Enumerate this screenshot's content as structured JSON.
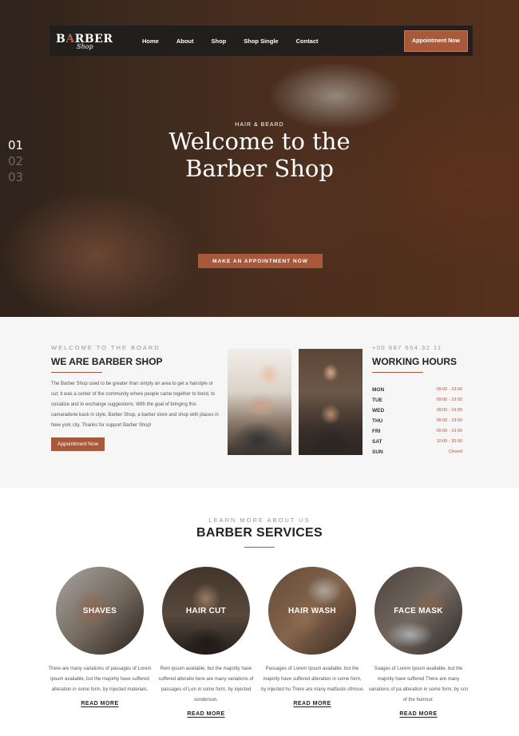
{
  "brand": {
    "logo_main_prefix": "B",
    "logo_main_accent": "A",
    "logo_main_suffix": "RBER",
    "logo_sub": "Shop",
    "accent_color": "#a8593b"
  },
  "nav": {
    "items": [
      "Home",
      "About",
      "Shop",
      "Shop Single",
      "Contact"
    ],
    "appointment_button": "Appointment Now"
  },
  "hero": {
    "slides": [
      "01",
      "02",
      "03"
    ],
    "active_slide": 0,
    "eyebrow": "HAIR & BEARD",
    "title_line1": "Welcome to the",
    "title_line2": "Barber Shop",
    "cta": "MAKE AN APPOINTMENT NOW"
  },
  "about": {
    "eyebrow": "WELCOME TO THE BOARD",
    "title": "WE ARE BARBER SHOP",
    "paragraph": "The Barber Shop used to be greater than simply an area to get a hairstyle or cut; it was a center of the community where people came together to bond, to socialize and to exchange suggestions. With the goal of bringing this camaraderie back in style, Barber Shop, a barber store and shop with places in New york city. Thanks for support Barber Shop!",
    "button": "Appointment Now"
  },
  "hours": {
    "phone": "+00 987 654 32 11",
    "title": "WORKING HOURS",
    "rows": [
      {
        "day": "MON",
        "time": "09:00 - 19:00"
      },
      {
        "day": "TUE",
        "time": "09:00 - 19:00"
      },
      {
        "day": "WED",
        "time": "09:00 - 19:00"
      },
      {
        "day": "THU",
        "time": "09:00 - 19:00"
      },
      {
        "day": "FRI",
        "time": "09:00 - 19:00"
      },
      {
        "day": "SAT",
        "time": "10:00 - 20:00"
      },
      {
        "day": "SUN",
        "time": "Closed"
      }
    ]
  },
  "services": {
    "eyebrow": "LEARN MORE ABOUT US",
    "title": "BARBER SERVICES",
    "items": [
      {
        "label": "SHAVES",
        "text": "There are many variations of passages of Lorem Ipsum available, but the majority have suffered alteration in some form, by injected materials.",
        "link": "READ MORE"
      },
      {
        "label": "HAIR CUT",
        "text": "Rem ipsum available, but the majority have suffered alteratio here are many variations of passages of Lon in some form, by injected sonderson.",
        "link": "READ MORE"
      },
      {
        "label": "HAIR WASH",
        "text": "Passages of Lorem Ipsum available, but the majority have suffered alteration in some form, by injected hu There are many matfastis ofmous",
        "link": "READ MORE"
      },
      {
        "label": "FACE MASK",
        "text": "Soages of Lorem Ipsum available, but the majority have suffered There are many variations of pa alteration in some form, by scn of the humour.",
        "link": "READ MORE"
      }
    ]
  }
}
